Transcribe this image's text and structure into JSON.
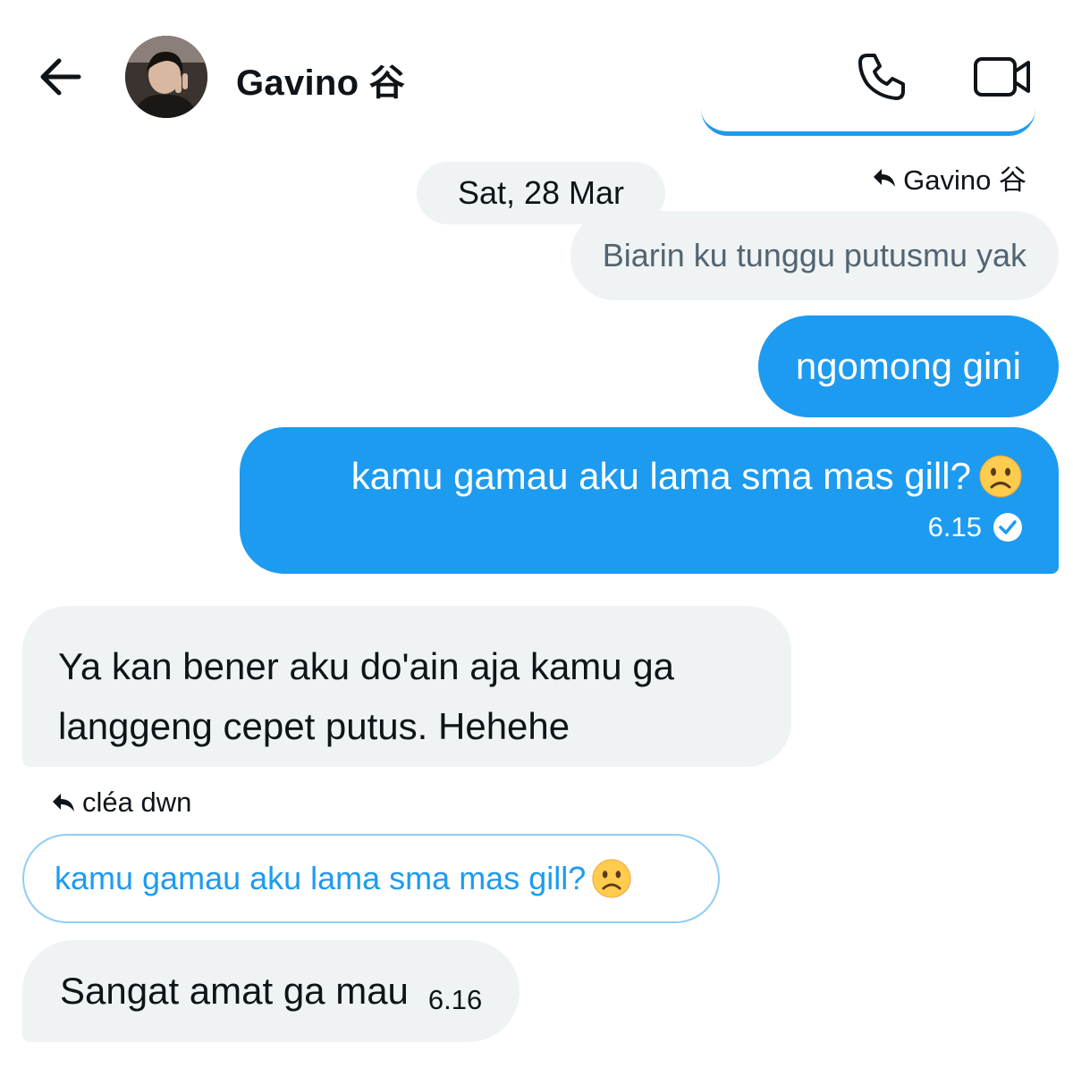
{
  "header": {
    "contact_name": "Gavino 谷",
    "back_icon": "arrow-left-icon",
    "call_icon": "phone-icon",
    "video_icon": "video-camera-icon"
  },
  "thread": {
    "date_separator": "Sat, 28 Mar",
    "reply_to_gavino": {
      "label": "Gavino 谷",
      "quoted_text": "Biarin ku tunggu putusmu yak"
    },
    "outgoing": [
      {
        "text": "ngomong gini"
      },
      {
        "text": "kamu gamau aku lama sma mas gill?",
        "emoji": "frowning-face-icon",
        "time": "6.15",
        "status_icon": "sent-check-icon"
      }
    ],
    "incoming_first": {
      "line1": "Ya kan bener aku do'ain aja kamu ga",
      "line2": "langgeng cepet putus. Hehehe"
    },
    "reply_to_clea": {
      "label": "cléa dwn",
      "quoted_text": "kamu gamau aku lama sma mas gill?",
      "emoji": "frowning-face-icon"
    },
    "incoming_last": {
      "text": "Sangat amat ga mau",
      "time": "6.16"
    }
  },
  "colors": {
    "accent": "#1d9bf0",
    "bubble_in": "#eff3f4",
    "muted_text": "#536471"
  }
}
